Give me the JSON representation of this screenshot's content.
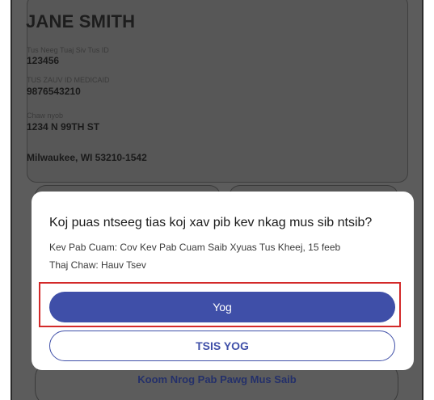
{
  "card": {
    "name": "JANE SMITH",
    "member_id_label": "Tus Neeg Tuaj Siv Tus ID",
    "member_id": "123456",
    "medicaid_label": "TUS ZAUV ID MEDICAID",
    "medicaid_id": "9876543210",
    "address_label": "Chaw nyob",
    "address_line1": "1234 N 99TH ST",
    "address_line2": "Milwaukee, WI 53210-1542"
  },
  "background_button": {
    "label": "Koom Nrog Pab Pawg Mus Saib"
  },
  "modal": {
    "question": "Koj puas ntseeg tias koj xav pib kev nkag mus sib ntsib?",
    "service_line": "Kev Pab Cuam: Cov Kev Pab Cuam Saib Xyuas Tus Kheej, 15 feeb",
    "time_line": "Thaj Chaw: Hauv Tsev",
    "yes_label": "Yog",
    "no_label": "TSIS YOG"
  },
  "colors": {
    "primary": "#3f4fa8",
    "highlight": "#d32a2a",
    "overlay": "#5c5c5c"
  }
}
